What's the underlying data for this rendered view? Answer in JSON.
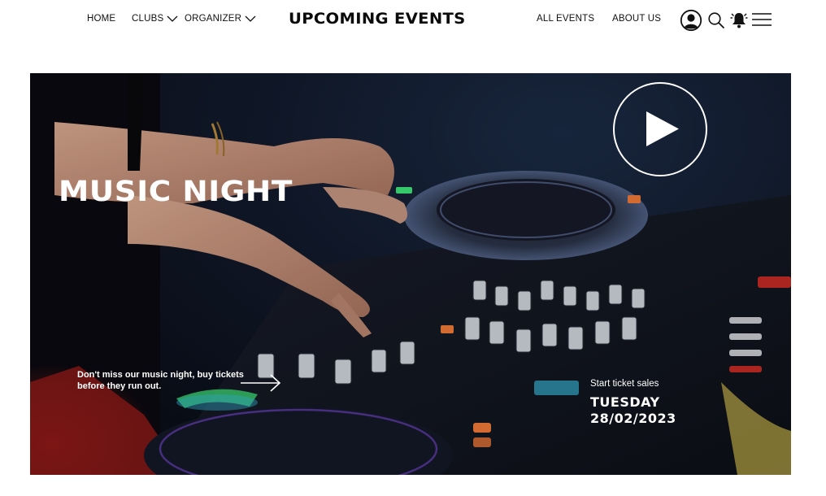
{
  "nav": {
    "home": "HOME",
    "clubs": "CLUBS",
    "organizer": "ORGANIZER",
    "brand": "UPCOMING EVENTS",
    "all_events": "ALL EVENTS",
    "about_us": "ABOUT US",
    "icons": [
      "user-icon",
      "search-icon",
      "bell-icon",
      "menu-icon"
    ]
  },
  "hero": {
    "title": "MUSIC NIGHT",
    "promo_text": "Don't miss our music night, buy tickets before they run out.",
    "sale_label": "Start ticket sales",
    "sale_day": "TUESDAY",
    "sale_date": "28/02/2023",
    "colors": {
      "background": "#0d1220",
      "text": "#ffffff",
      "accent_red": "#d2261e",
      "accent_green": "#3ee57a",
      "accent_cyan": "#37b6d8",
      "accent_orange": "#f07a3a"
    }
  }
}
